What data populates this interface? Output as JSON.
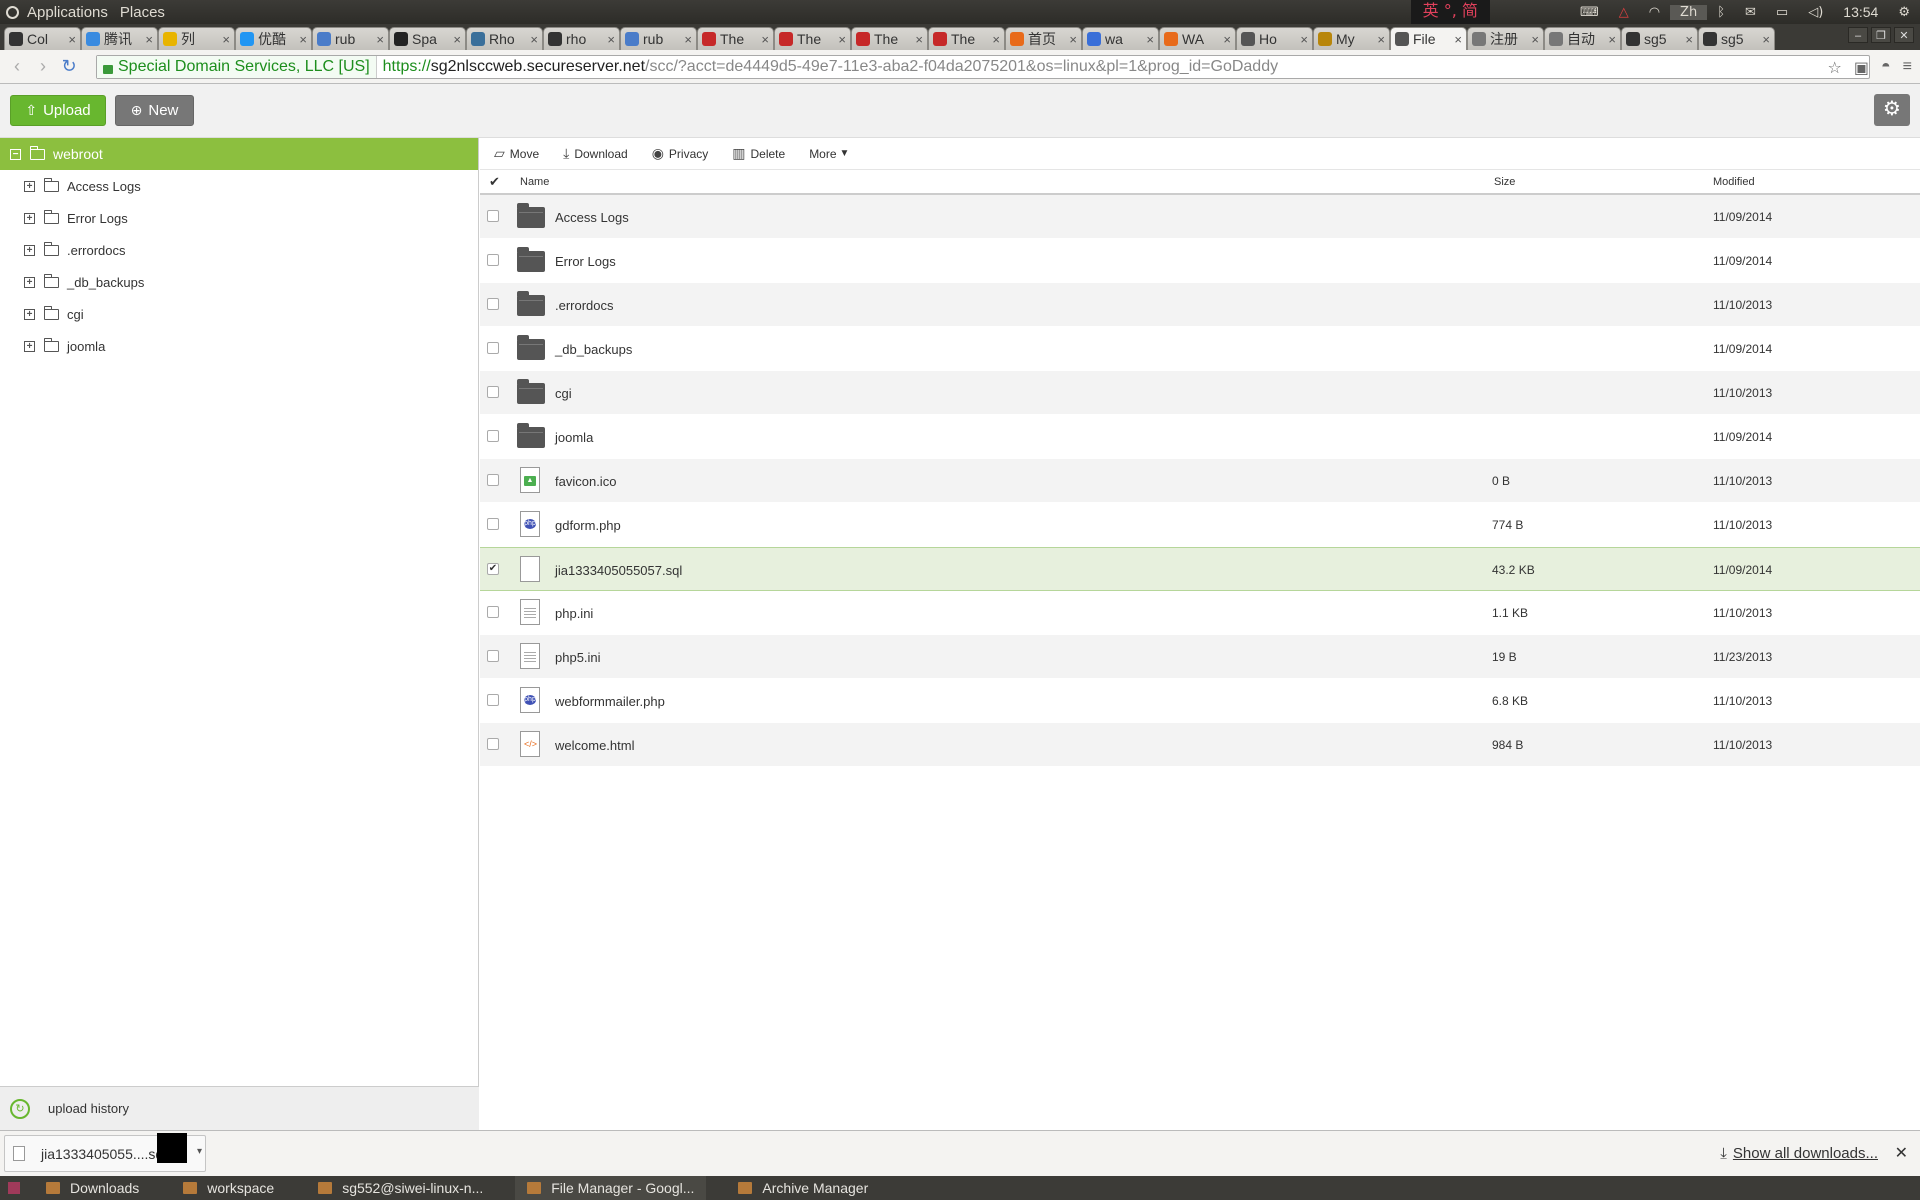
{
  "panel": {
    "menu": [
      "Applications",
      "Places"
    ],
    "ime": "英 °, 简",
    "lang": "Zh",
    "time": "13:54"
  },
  "tabs": [
    {
      "label": "Col",
      "color": "#333"
    },
    {
      "label": "腾讯",
      "color": "#3a8be0"
    },
    {
      "label": "列",
      "color": "#e8b400"
    },
    {
      "label": "优酷",
      "color": "#2196f3"
    },
    {
      "label": "rub",
      "color": "#4a7cc9"
    },
    {
      "label": "Spa",
      "color": "#222"
    },
    {
      "label": "Rho",
      "color": "#3a6f9a"
    },
    {
      "label": "rho",
      "color": "#333"
    },
    {
      "label": "rub",
      "color": "#4a7cc9"
    },
    {
      "label": "The",
      "color": "#c62828"
    },
    {
      "label": "The",
      "color": "#c62828"
    },
    {
      "label": "The",
      "color": "#c62828"
    },
    {
      "label": "The",
      "color": "#c62828"
    },
    {
      "label": "首页",
      "color": "#e86a1a"
    },
    {
      "label": "wa",
      "color": "#3a6fd8"
    },
    {
      "label": "WA",
      "color": "#e86a1a"
    },
    {
      "label": "Ho",
      "color": "#555"
    },
    {
      "label": "My",
      "color": "#b8860b"
    },
    {
      "label": "File",
      "color": "#555",
      "active": true
    },
    {
      "label": "注册",
      "color": "#777"
    },
    {
      "label": "自动",
      "color": "#777"
    },
    {
      "label": "sg5",
      "color": "#333"
    },
    {
      "label": "sg5",
      "color": "#333"
    }
  ],
  "address": {
    "ev_label": "Special Domain Services, LLC [US]",
    "scheme": "https://",
    "host": "sg2nlsccweb.secureserver.net",
    "path": "/scc/?acct=de4449d5-49e7-11e3-aba2-f04da2075201&os=linux&pl=1&prog_id=GoDaddy"
  },
  "toolbar": {
    "upload_label": "Upload",
    "new_label": "New"
  },
  "tree": {
    "root": "webroot",
    "items": [
      "Access Logs",
      "Error Logs",
      ".errordocs",
      "_db_backups",
      "cgi",
      "joomla"
    ]
  },
  "actions": {
    "move": "Move",
    "download": "Download",
    "privacy": "Privacy",
    "delete": "Delete",
    "more": "More"
  },
  "columns": {
    "name": "Name",
    "size": "Size",
    "modified": "Modified"
  },
  "files": [
    {
      "name": "Access Logs",
      "size": "",
      "modified": "11/09/2014",
      "type": "folder"
    },
    {
      "name": "Error Logs",
      "size": "",
      "modified": "11/09/2014",
      "type": "folder"
    },
    {
      "name": ".errordocs",
      "size": "",
      "modified": "11/10/2013",
      "type": "folder"
    },
    {
      "name": "_db_backups",
      "size": "",
      "modified": "11/09/2014",
      "type": "folder"
    },
    {
      "name": "cgi",
      "size": "",
      "modified": "11/10/2013",
      "type": "folder"
    },
    {
      "name": "joomla",
      "size": "",
      "modified": "11/09/2014",
      "type": "folder"
    },
    {
      "name": "favicon.ico",
      "size": "0 B",
      "modified": "11/10/2013",
      "type": "image"
    },
    {
      "name": "gdform.php",
      "size": "774 B",
      "modified": "11/10/2013",
      "type": "php"
    },
    {
      "name": "jia1333405055057.sql",
      "size": "43.2 KB",
      "modified": "11/09/2014",
      "type": "file",
      "selected": true
    },
    {
      "name": "php.ini",
      "size": "1.1 KB",
      "modified": "11/10/2013",
      "type": "text"
    },
    {
      "name": "php5.ini",
      "size": "19 B",
      "modified": "11/23/2013",
      "type": "text"
    },
    {
      "name": "webformmailer.php",
      "size": "6.8 KB",
      "modified": "11/10/2013",
      "type": "php"
    },
    {
      "name": "welcome.html",
      "size": "984 B",
      "modified": "11/10/2013",
      "type": "html"
    }
  ],
  "upload_history": "upload history",
  "downloads": {
    "item": "jia1333405055....sql",
    "show_all": "Show all downloads..."
  },
  "taskbar": [
    {
      "label": "Downloads"
    },
    {
      "label": "workspace"
    },
    {
      "label": "sg552@siwei-linux-n..."
    },
    {
      "label": "File Manager - Googl...",
      "active": true
    },
    {
      "label": "Archive Manager"
    }
  ]
}
